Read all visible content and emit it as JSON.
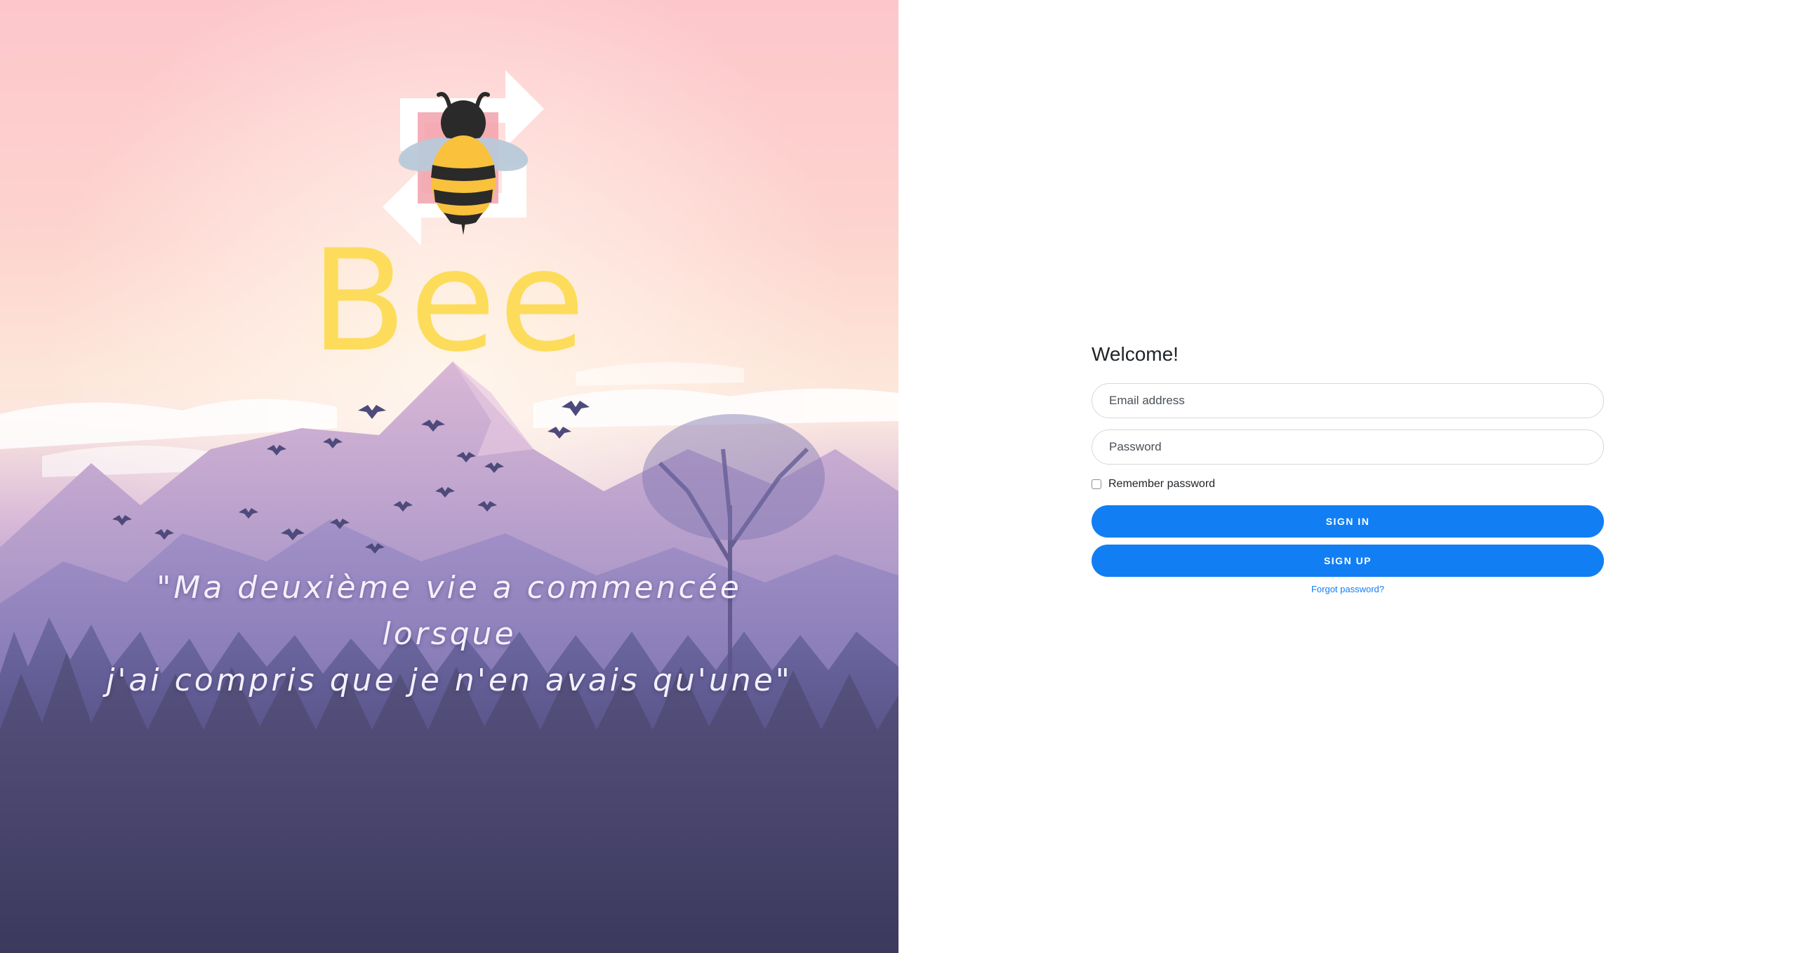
{
  "hero": {
    "brand": "Bee",
    "quote_line1": "\"Ma deuxième vie a commencée lorsque",
    "quote_line2": "j'ai compris que je n'en avais qu'une\"",
    "logo_icon": "bee-exchange-icon",
    "colors": {
      "brand": "#fddc5c",
      "sky_top": "#fdc6cb",
      "mountain": "#b9a0cf",
      "forest": "#4a466f"
    }
  },
  "auth": {
    "title": "Welcome!",
    "email_placeholder": "Email address",
    "password_placeholder": "Password",
    "remember_label": "Remember password",
    "remember_checked": false,
    "sign_in_label": "SIGN IN",
    "sign_up_label": "SIGN UP",
    "forgot_label": "Forgot password?",
    "colors": {
      "primary": "#127ef4",
      "text": "#212529"
    }
  }
}
